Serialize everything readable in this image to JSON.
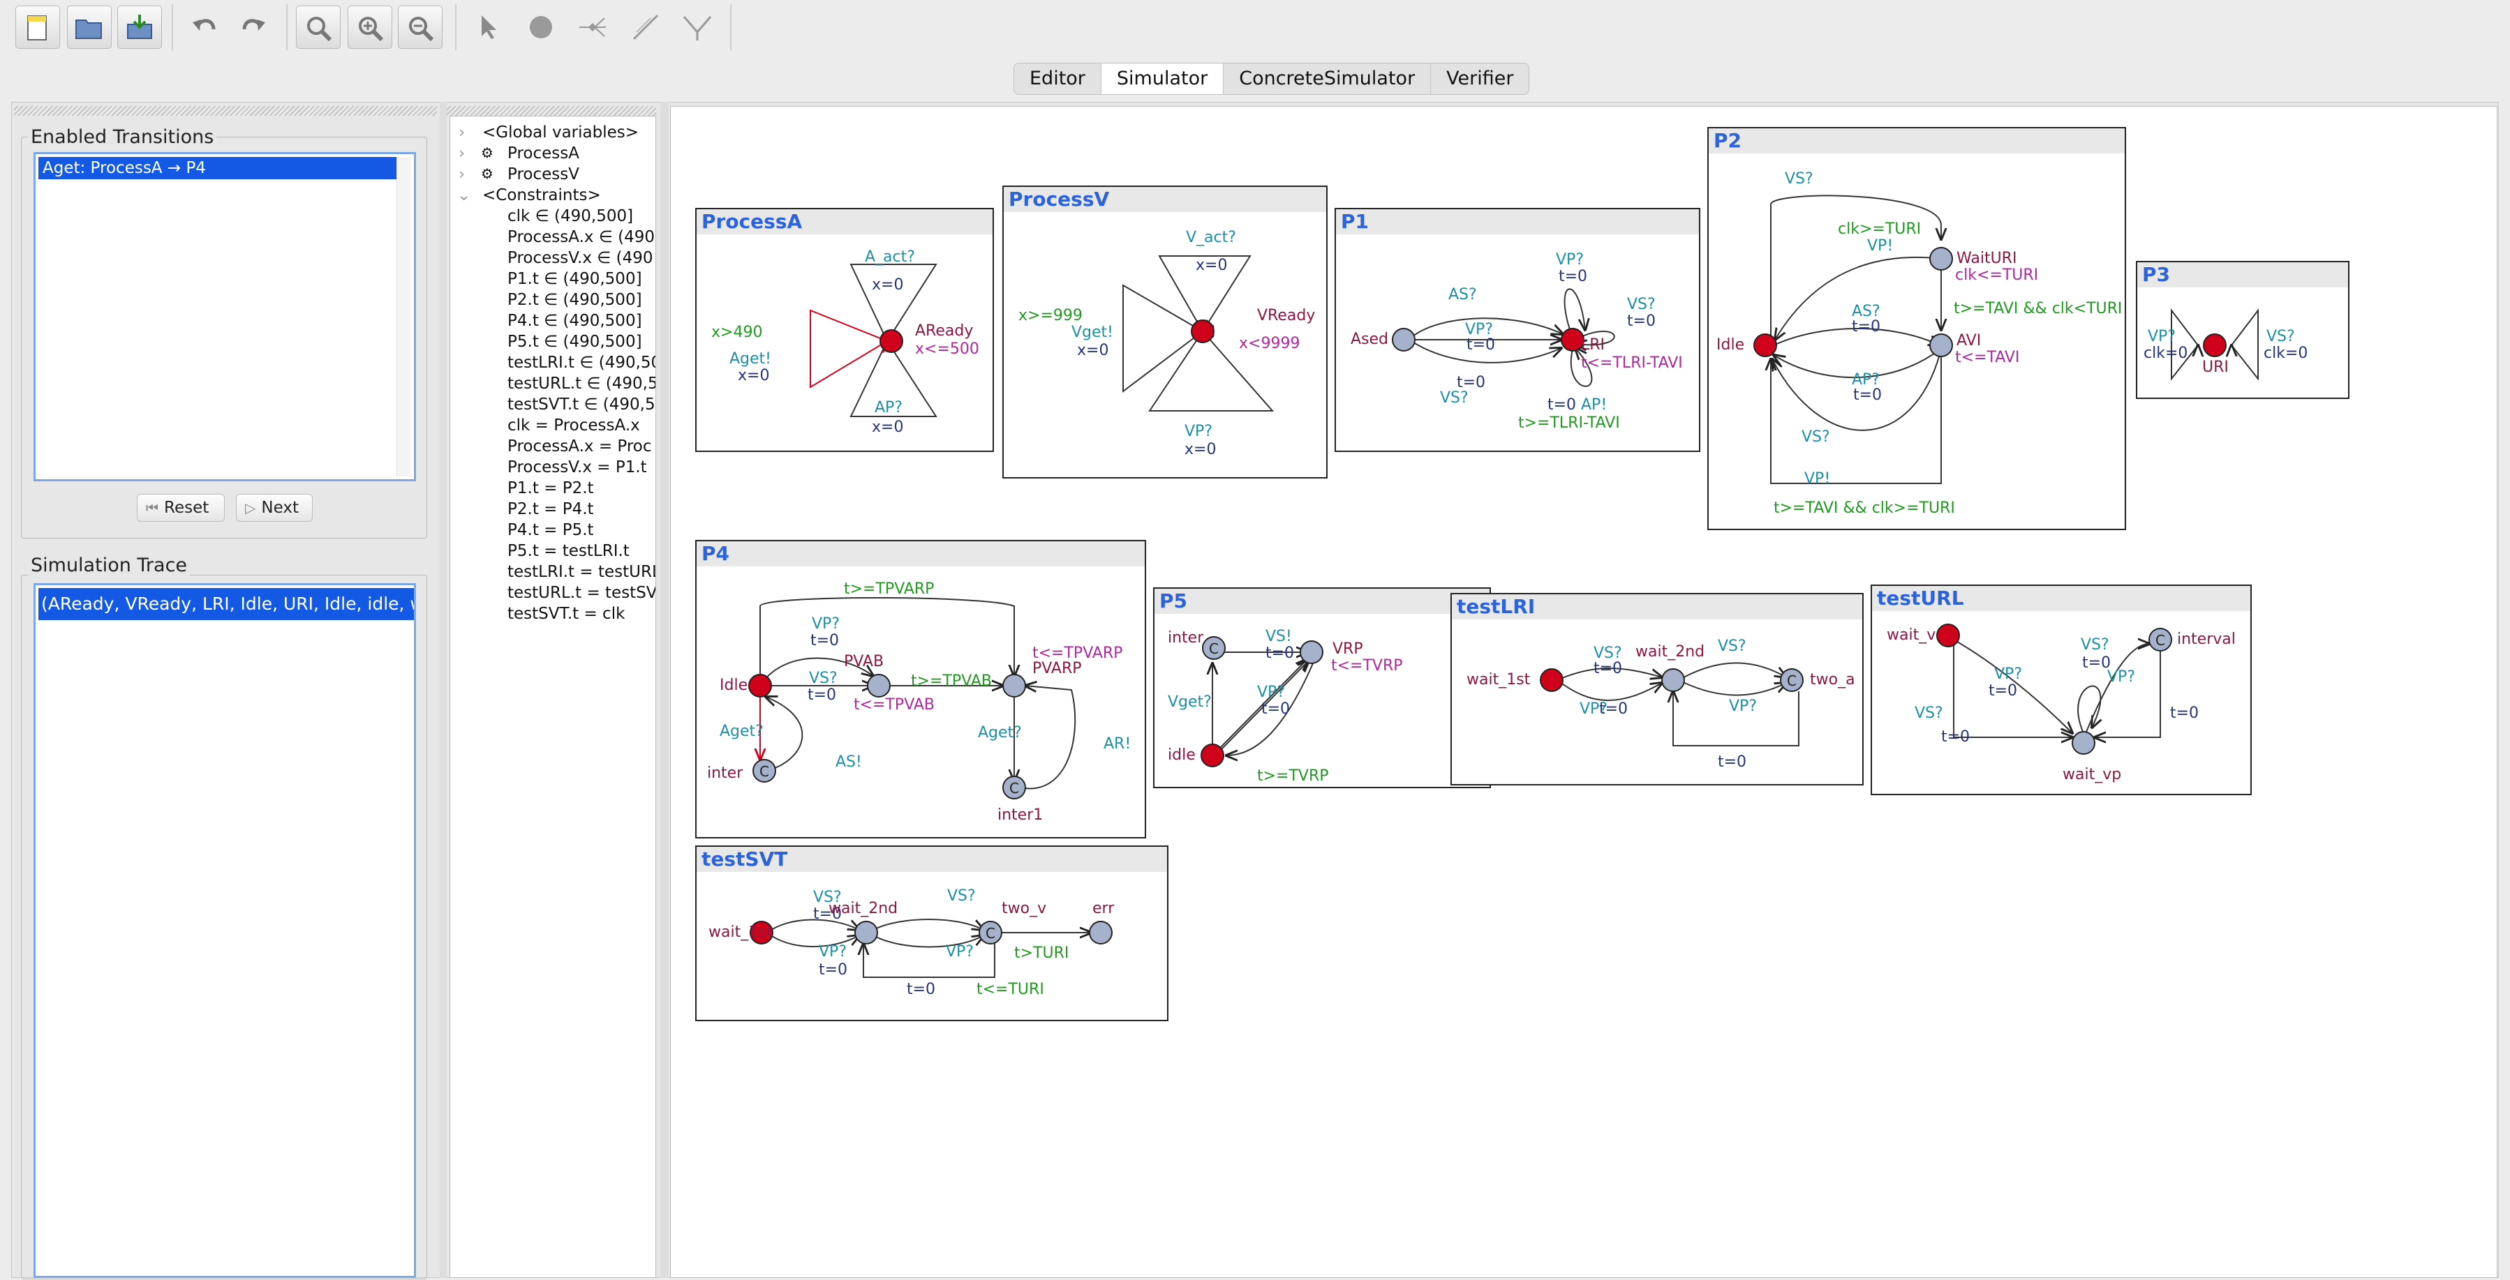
{
  "toolbar": {
    "buttons": [
      "new-document-icon",
      "open-icon",
      "save-icon",
      "undo-icon",
      "redo-icon",
      "zoom-to-fit-icon",
      "zoom-in-icon",
      "zoom-out-icon",
      "select-tool-icon",
      "location-tool-icon",
      "branch-tool-icon",
      "edge-tool-icon",
      "nail-tool-icon"
    ]
  },
  "tabs": [
    {
      "label": "Editor"
    },
    {
      "label": "Simulator"
    },
    {
      "label": "ConcreteSimulator"
    },
    {
      "label": "Verifier"
    }
  ],
  "enabled_transitions": {
    "title": "Enabled Transitions",
    "items": [
      "Aget: ProcessA → P4"
    ],
    "reset_label": "Reset",
    "next_label": "Next"
  },
  "simulation_trace": {
    "title": "Simulation Trace",
    "items": [
      "(AReady, VReady, LRI, Idle, URI, Idle, idle, wait"
    ]
  },
  "tree": {
    "global": "<Global variables>",
    "proc_a": "ProcessA",
    "proc_v": "ProcessV",
    "constraints": "<Constraints>",
    "rows": [
      "clk ∈ (490,500]",
      "ProcessA.x ∈ (490",
      "ProcessV.x ∈ (490",
      "P1.t ∈ (490,500]",
      "P2.t ∈ (490,500]",
      "P4.t ∈ (490,500]",
      "P5.t ∈ (490,500]",
      "testLRI.t ∈ (490,50",
      "testURL.t ∈ (490,5",
      "testSVT.t ∈ (490,5",
      "clk = ProcessA.x",
      "ProcessA.x = Proc",
      "ProcessV.x = P1.t",
      "P1.t = P2.t",
      "P2.t = P4.t",
      "P4.t = P5.t",
      "P5.t = testLRI.t",
      "testLRI.t = testURL",
      "testURL.t = testSV",
      "testSVT.t = clk"
    ]
  },
  "colors": {
    "active_location": "#d0021b",
    "location": "#a6b1cc",
    "guard": "#1f9a1f",
    "sync": "#1a8fa6",
    "update": "#25337f",
    "invariant": "#b0279c",
    "name": "#8c1640",
    "title": "#2e63d8"
  },
  "templates": {
    "processA": {
      "title": "ProcessA",
      "labels": [
        "A_act?",
        "x=0",
        "AReady",
        "x<=500",
        "x>490",
        "Aget!",
        "x=0",
        "AP?",
        "x=0"
      ]
    },
    "processV": {
      "title": "ProcessV",
      "labels": [
        "V_act?",
        "x=0",
        "VReady",
        "x<9999",
        "x>=999",
        "Vget!",
        "x=0",
        "VP?",
        "x=0"
      ]
    },
    "p1": {
      "title": "P1",
      "labels": [
        "VP?",
        "t=0",
        "AS?",
        "VS?",
        "t=0",
        "Ased",
        "VP?",
        "t=0",
        "LRI",
        "t<=TLRI-TAVI",
        "t=0",
        "VS?",
        "t=0",
        "AP!",
        "t>=TLRI-TAVI"
      ]
    },
    "p2": {
      "title": "P2",
      "labels": [
        "VS?",
        "clk>=TURI",
        "VP!",
        "WaitURI",
        "clk<=TURI",
        "t>=TAVI && clk<TURI",
        "Idle",
        "AS?",
        "t=0",
        "AVI",
        "t<=TAVI",
        "AP?",
        "t=0",
        "VS?",
        "VP!",
        "t>=TAVI && clk>=TURI"
      ]
    },
    "p3": {
      "title": "P3",
      "labels": [
        "VP?",
        "clk=0",
        "VS?",
        "clk=0",
        "URI"
      ]
    },
    "p4": {
      "title": "P4",
      "labels": [
        "t>=TPVARP",
        "VP?",
        "t=0",
        "PVAB",
        "t<=TPVARP",
        "PVARP",
        "Idle",
        "VS?",
        "t=0",
        "t>=TPVAB",
        "t<=TPVAB",
        "Aget?",
        "AS!",
        "Aget?",
        "AR!",
        "inter",
        "inter1"
      ]
    },
    "p5": {
      "title": "P5",
      "labels": [
        "inter",
        "VS!",
        "t=0",
        "VRP",
        "t<=TVRP",
        "Vget?",
        "VP?",
        "t=0",
        "idle",
        "t>=TVRP"
      ]
    },
    "testLRI": {
      "title": "testLRI",
      "labels": [
        "wait_1st",
        "VS?",
        "t=0",
        "wait_2nd",
        "VS?",
        "VP?",
        "t=0",
        "VP?",
        "two_a",
        "t=0"
      ]
    },
    "testURL": {
      "title": "testURL",
      "labels": [
        "wait_v",
        "VS?",
        "t=0",
        "VP?",
        "t=0",
        "VP?",
        "VS?",
        "interval",
        "t=0",
        "t=0",
        "wait_vp"
      ]
    },
    "testSVT": {
      "title": "testSVT",
      "labels": [
        "VS?",
        "t=0",
        "wait_2nd",
        "VS?",
        "two_v",
        "err",
        "wait_1st",
        "VP?",
        "t=0",
        "VP?",
        "t>TURI",
        "t=0",
        "t<=TURI"
      ]
    }
  }
}
